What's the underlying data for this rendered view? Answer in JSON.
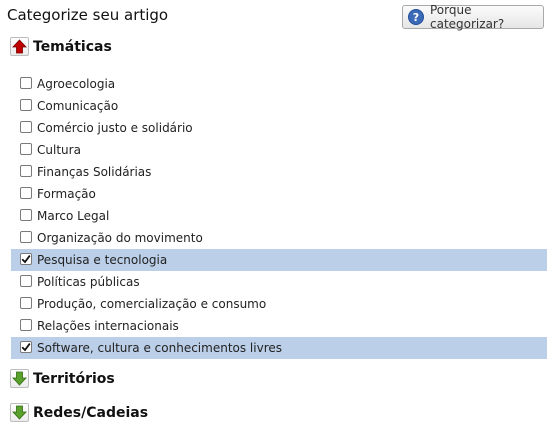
{
  "title": "Categorize seu artigo",
  "help_button": {
    "label": "Porque categorizar?",
    "icon": "question-icon"
  },
  "colors": {
    "selected_row": "#bccfe8",
    "arrow_up": "#c00000",
    "arrow_down": "#5aa02c",
    "help_icon": "#3a6ab8"
  },
  "sections": [
    {
      "label": "Temáticas",
      "expanded": true,
      "icon": "arrow-up-icon",
      "items": [
        {
          "label": "Agroecologia",
          "checked": false
        },
        {
          "label": "Comunicação",
          "checked": false
        },
        {
          "label": "Comércio justo e solidário",
          "checked": false
        },
        {
          "label": "Cultura",
          "checked": false
        },
        {
          "label": "Finanças Solidárias",
          "checked": false
        },
        {
          "label": "Formação",
          "checked": false
        },
        {
          "label": "Marco Legal",
          "checked": false
        },
        {
          "label": "Organização do movimento",
          "checked": false
        },
        {
          "label": "Pesquisa e tecnologia",
          "checked": true
        },
        {
          "label": "Políticas públicas",
          "checked": false
        },
        {
          "label": "Produção, comercialização e consumo",
          "checked": false
        },
        {
          "label": "Relações internacionais",
          "checked": false
        },
        {
          "label": "Software, cultura e conhecimentos livres",
          "checked": true
        }
      ]
    },
    {
      "label": "Territórios",
      "expanded": false,
      "icon": "arrow-down-icon"
    },
    {
      "label": "Redes/Cadeias",
      "expanded": false,
      "icon": "arrow-down-icon"
    }
  ]
}
